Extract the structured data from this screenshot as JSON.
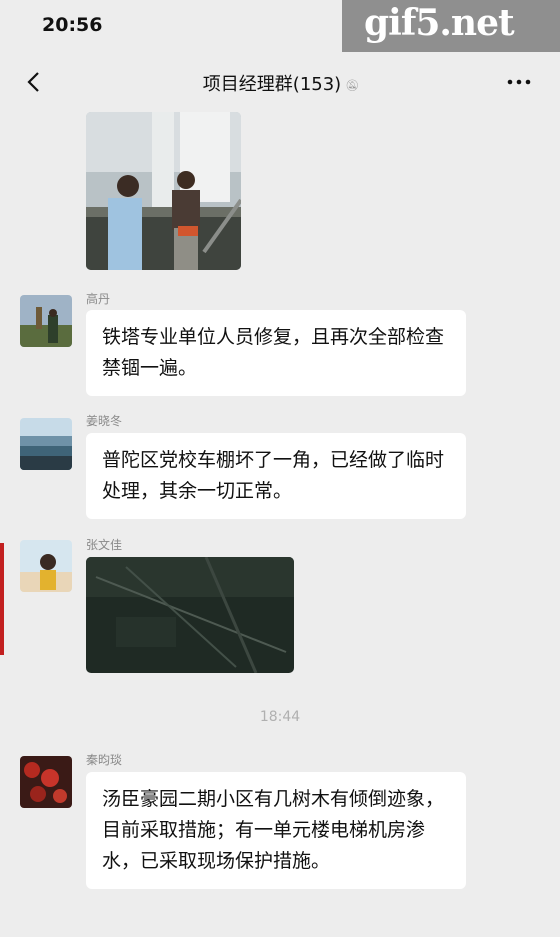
{
  "status_bar": {
    "time": "20:56"
  },
  "watermark": {
    "text": "gif5.net"
  },
  "nav": {
    "title": "项目经理群(153)"
  },
  "messages": [
    {
      "type": "image",
      "content": "photo"
    },
    {
      "sender": "高丹",
      "text": "铁塔专业单位人员修复，且再次全部检查禁锢一遍。"
    },
    {
      "sender": "姜晓冬",
      "text": "普陀区党校车棚坏了一角，已经做了临时处理，其余一切正常。"
    },
    {
      "sender": "张文佳",
      "type": "image",
      "content": "photo"
    },
    {
      "timestamp": "18:44"
    },
    {
      "sender": "秦昀琰",
      "text": "汤臣豪园二期小区有几树木有倾倒迹象，目前采取措施；有一单元楼电梯机房渗水，已采取现场保护措施。"
    }
  ],
  "colors": {
    "background": "#ededed",
    "bubble": "#ffffff",
    "accent_edge": "#c21f1f"
  }
}
